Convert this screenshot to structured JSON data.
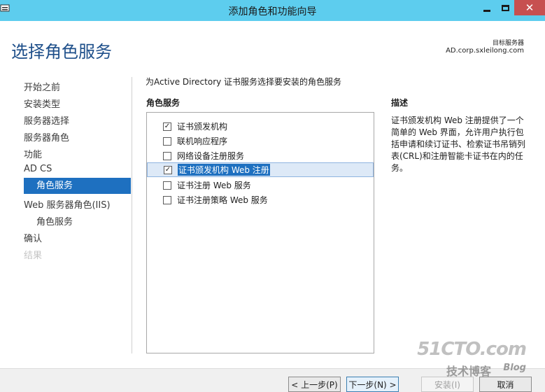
{
  "window": {
    "title": "添加角色和功能向导",
    "close_glyph": "✕"
  },
  "header": {
    "page_title": "选择角色服务",
    "target_label": "目标服务器",
    "target_value": "AD.corp.sxleilong.com"
  },
  "nav": {
    "items": [
      {
        "label": "开始之前"
      },
      {
        "label": "安装类型"
      },
      {
        "label": "服务器选择"
      },
      {
        "label": "服务器角色"
      },
      {
        "label": "功能"
      },
      {
        "label": "AD CS"
      },
      {
        "label": "角色服务"
      },
      {
        "label": "Web 服务器角色(IIS)"
      },
      {
        "label": "角色服务"
      },
      {
        "label": "确认"
      },
      {
        "label": "结果"
      }
    ]
  },
  "main": {
    "instruction": "为Active Directory 证书服务选择要安装的角色服务",
    "roles_header": "角色服务",
    "roles": [
      {
        "label": "证书颁发机构",
        "checked": true
      },
      {
        "label": "联机响应程序",
        "checked": false
      },
      {
        "label": "网络设备注册服务",
        "checked": false
      },
      {
        "label": "证书颁发机构 Web 注册",
        "checked": true
      },
      {
        "label": "证书注册 Web 服务",
        "checked": false
      },
      {
        "label": "证书注册策略 Web 服务",
        "checked": false
      }
    ],
    "check_glyph": "✓"
  },
  "description": {
    "header": "描述",
    "text": "证书颁发机构 Web 注册提供了一个简单的 Web 界面，允许用户执行包括申请和续订证书、检索证书吊销列表(CRL)和注册智能卡证书在内的任务。"
  },
  "footer": {
    "prev": "< 上一步(P)",
    "next": "下一步(N) >",
    "install": "安装(I)",
    "cancel": "取消"
  },
  "watermark": {
    "main": "51CTO.com",
    "sub": "技术博客",
    "blog": "Blog"
  }
}
